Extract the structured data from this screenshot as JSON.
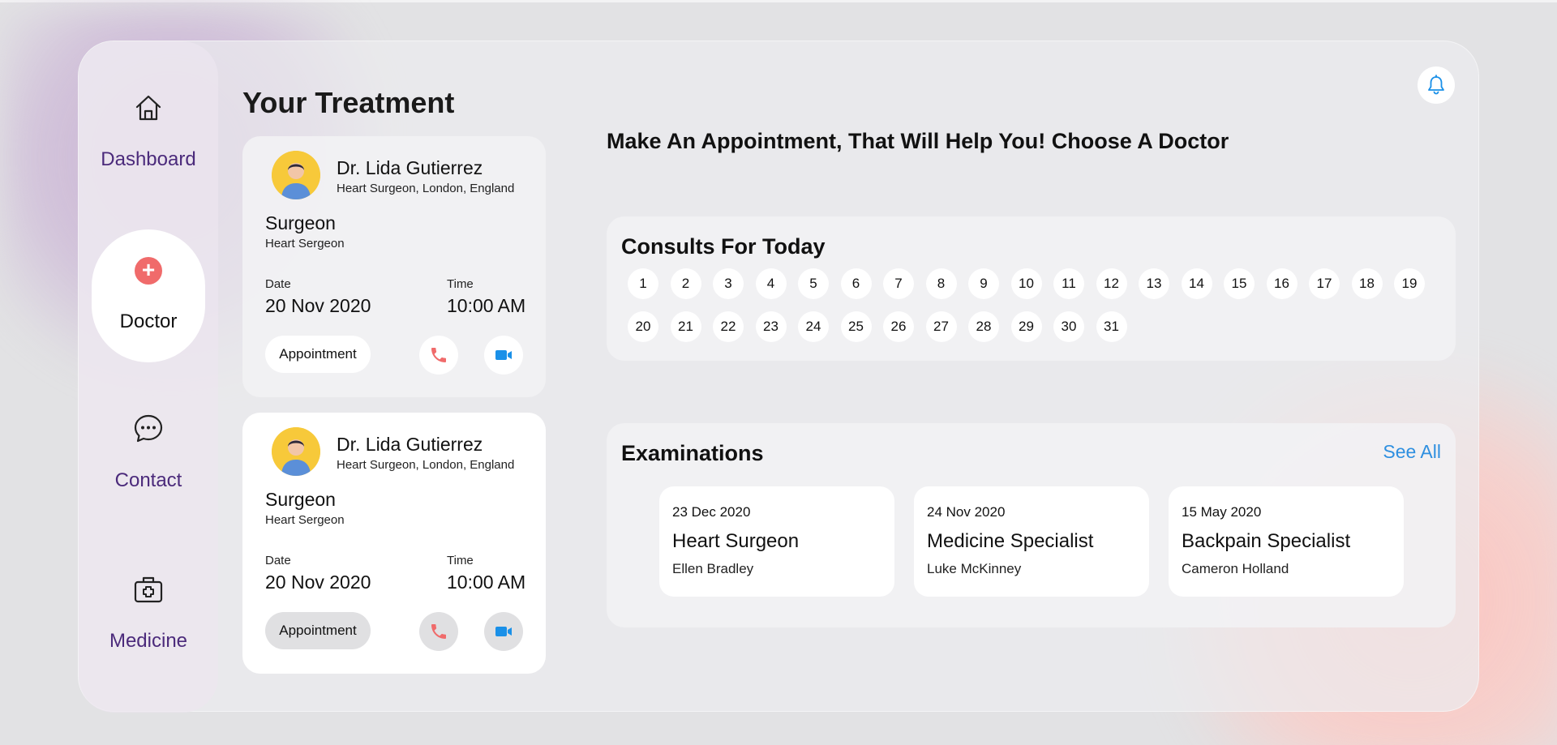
{
  "sidebar": {
    "items": [
      {
        "label": "Dashboard",
        "icon": "home-icon"
      },
      {
        "label": "Doctor",
        "icon": "plus-circle-icon"
      },
      {
        "label": "Contact",
        "icon": "chat-icon"
      },
      {
        "label": "Medicine",
        "icon": "medical-kit-icon"
      }
    ]
  },
  "treatment": {
    "title": "Your Treatment",
    "cards": [
      {
        "doctor_name": "Dr. Lida Gutierrez",
        "doctor_sub": "Heart Surgeon, London, England",
        "role": "Surgeon",
        "role_sub": "Heart Sergeon",
        "date_label": "Date",
        "date_value": "20 Nov 2020",
        "time_label": "Time",
        "time_value": "10:00 AM",
        "appointment_label": "Appointment"
      },
      {
        "doctor_name": "Dr. Lida Gutierrez",
        "doctor_sub": "Heart Surgeon, London, England",
        "role": "Surgeon",
        "role_sub": "Heart Sergeon",
        "date_label": "Date",
        "date_value": "20 Nov 2020",
        "time_label": "Time",
        "time_value": "10:00 AM",
        "appointment_label": "Appointment"
      }
    ]
  },
  "main": {
    "headline": "Make An Appointment, That Will Help You! Choose A Doctor",
    "consults": {
      "title": "Consults For Today",
      "days": [
        "1",
        "2",
        "3",
        "4",
        "5",
        "6",
        "7",
        "8",
        "9",
        "10",
        "11",
        "12",
        "13",
        "14",
        "15",
        "16",
        "17",
        "18",
        "19",
        "20",
        "21",
        "22",
        "23",
        "24",
        "25",
        "26",
        "27",
        "28",
        "29",
        "30",
        "31"
      ]
    },
    "examinations": {
      "title": "Examinations",
      "see_all": "See All",
      "items": [
        {
          "date": "23 Dec 2020",
          "title": "Heart Surgeon",
          "person": "Ellen Bradley"
        },
        {
          "date": "24 Nov 2020",
          "title": "Medicine Specialist",
          "person": "Luke McKinney"
        },
        {
          "date": "15 May 2020",
          "title": "Backpain Specialist",
          "person": "Cameron Holland"
        }
      ]
    }
  },
  "colors": {
    "accent_purple": "#4b2a7b",
    "call_red": "#f06b6b",
    "video_blue": "#1a90e8",
    "link_blue": "#2e8fe0"
  }
}
